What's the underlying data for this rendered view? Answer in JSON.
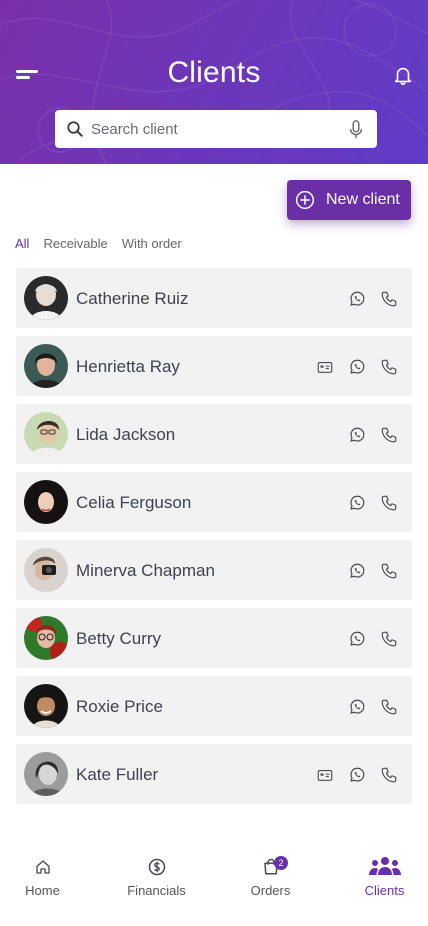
{
  "header": {
    "title": "Clients",
    "menu_icon": "menu-icon",
    "bell_icon": "bell-icon",
    "gradient": [
      "#7a2fa8",
      "#5f3cc6"
    ]
  },
  "search": {
    "placeholder": "Search client",
    "value": "",
    "icon": "search-icon",
    "mic_icon": "microphone-icon"
  },
  "new_client": {
    "label": "New client",
    "icon": "plus-circle-icon",
    "color": "#6a2fa6"
  },
  "filters": {
    "items": [
      "All",
      "Receivable",
      "With order"
    ],
    "active": "All"
  },
  "clients": [
    {
      "name": "Catherine Ruiz",
      "has_card": false
    },
    {
      "name": "Henrietta Ray",
      "has_card": true
    },
    {
      "name": "Lida Jackson",
      "has_card": false
    },
    {
      "name": "Celia Ferguson",
      "has_card": false
    },
    {
      "name": "Minerva Chapman",
      "has_card": false
    },
    {
      "name": "Betty Curry",
      "has_card": false
    },
    {
      "name": "Roxie Price",
      "has_card": false
    },
    {
      "name": "Kate Fuller",
      "has_card": true
    }
  ],
  "tabs": [
    {
      "label": "Home",
      "icon": "home-icon"
    },
    {
      "label": "Financials",
      "icon": "dollar-circle-icon"
    },
    {
      "label": "Orders",
      "icon": "shopping-bag-icon",
      "badge": "2"
    },
    {
      "label": "Clients",
      "icon": "users-icon",
      "active": true
    }
  ]
}
